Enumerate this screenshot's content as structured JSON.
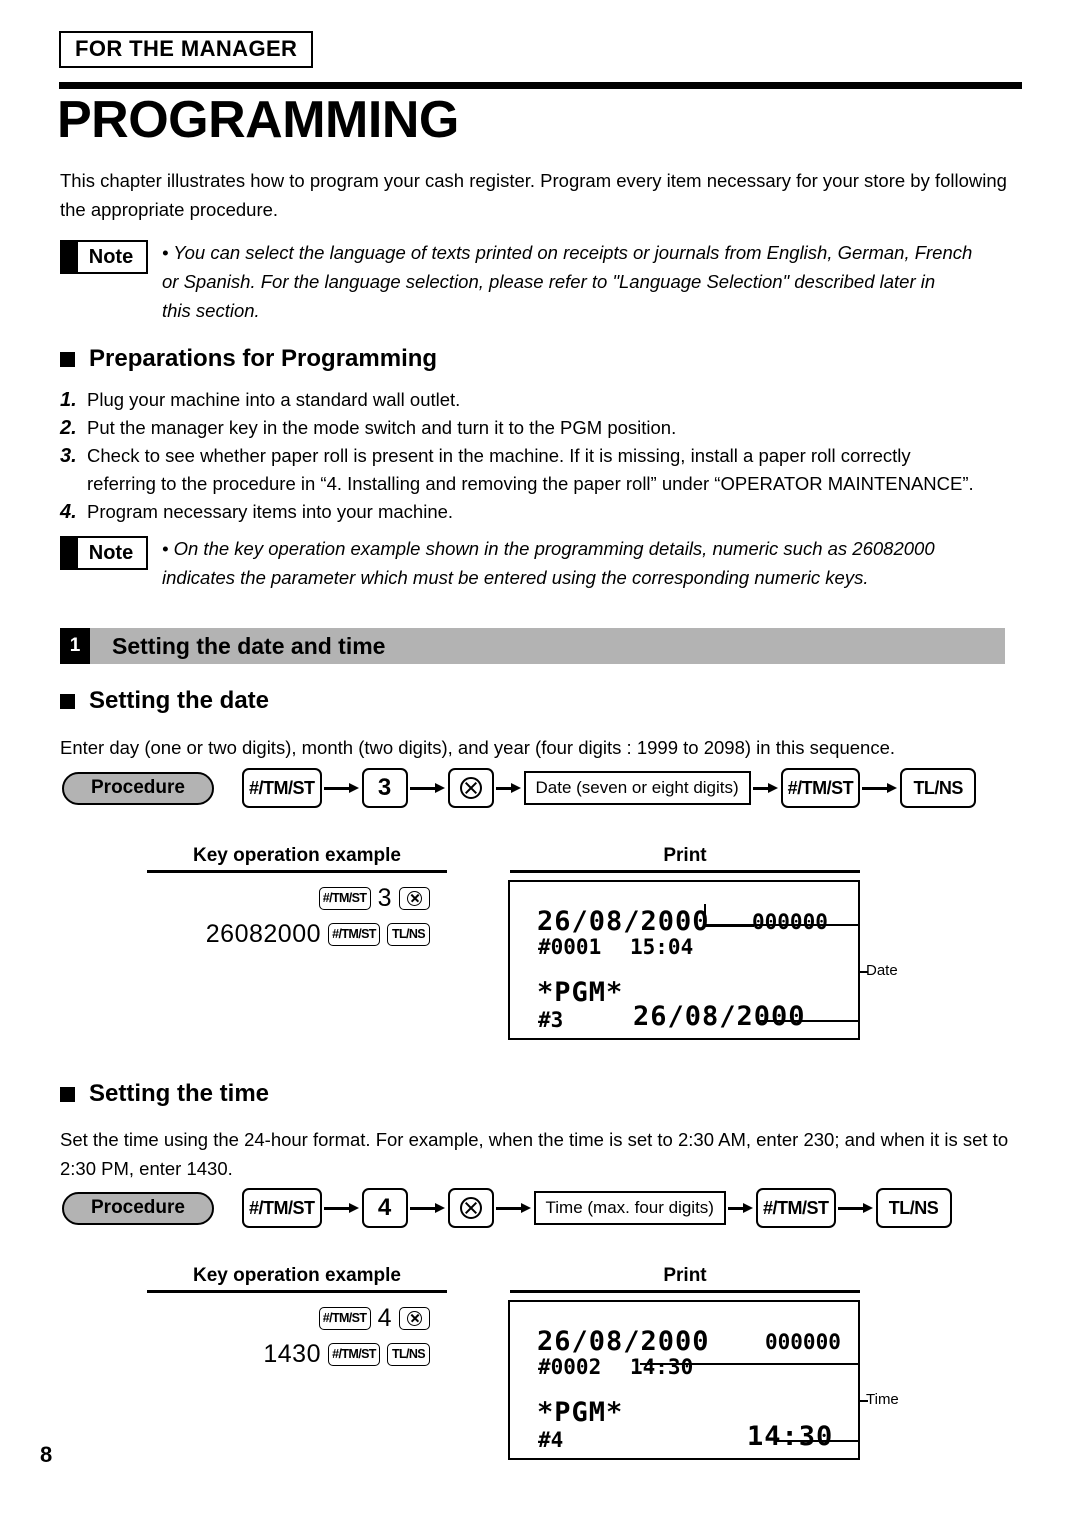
{
  "header": {
    "manager_tag": "FOR THE MANAGER",
    "chapter_title": "PROGRAMMING",
    "intro": "This chapter illustrates how to program your cash register.  Program every item necessary for your store by following the appropriate procedure."
  },
  "note_label": "Note",
  "bullet": "•",
  "note_1": {
    "line1": "• You can select the language of texts printed on receipts or journals from English, German, French",
    "line2": "or Spanish.  For the language selection, please refer to \"Language Selection\" described later in",
    "line3": "this section."
  },
  "preparations": {
    "heading": "Preparations for Programming",
    "items": [
      {
        "num": "1.",
        "text": "Plug your machine into a standard wall outlet."
      },
      {
        "num": "2.",
        "text": "Put the manager key in the mode switch and turn it to the PGM position."
      },
      {
        "num": "3.",
        "text": "Check to see whether paper roll is present in the machine.  If it is missing, install a paper roll correctly",
        "cont": "referring to the procedure in “4. Installing and removing the paper roll” under “OPERATOR MAINTENANCE”."
      },
      {
        "num": "4.",
        "text": "Program necessary items into your machine."
      }
    ]
  },
  "note_2": {
    "line1": "• On the key operation example shown in the programming details, numeric such as 26082000",
    "line2": "indicates the parameter which must be entered using the corresponding numeric keys."
  },
  "section": {
    "number": "1",
    "title": "Setting the date and time"
  },
  "date_section": {
    "heading": "Setting the date",
    "para": "Enter day (one or two digits), month (two digits), and year (four digits : 1999 to 2098) in this sequence.",
    "procedure_label": "Procedure",
    "flow": {
      "key1": "#/TM/ST",
      "key2": "3",
      "key3_icon": "multiply-circle-icon",
      "param": "Date (seven or eight digits)",
      "key4": "#/TM/ST",
      "key5": "TL/NS"
    },
    "example_head": "Key operation example",
    "print_head": "Print",
    "example": {
      "row1_key1": "#/TM/ST",
      "row1_num": "3",
      "row1_icon": "multiply-circle-icon",
      "row2_digits": "26082000",
      "row2_key1": "#/TM/ST",
      "row2_key2": "TL/NS"
    },
    "receipt": {
      "date_line": "26/08/2000",
      "counter": "000000",
      "consec": "#0001",
      "time": "15:04",
      "mode": "*PGM*",
      "code": "#3",
      "value": "26/08/2000",
      "callout": "Date"
    }
  },
  "time_section": {
    "heading": "Setting the time",
    "para": "Set the time using the 24-hour format.  For example, when the time is set to 2:30 AM, enter 230; and when it is set to 2:30 PM, enter 1430.",
    "procedure_label": "Procedure",
    "flow": {
      "key1": "#/TM/ST",
      "key2": "4",
      "key3_icon": "multiply-circle-icon",
      "param": "Time (max. four digits)",
      "key4": "#/TM/ST",
      "key5": "TL/NS"
    },
    "example_head": "Key operation example",
    "print_head": "Print",
    "example": {
      "row1_key1": "#/TM/ST",
      "row1_num": "4",
      "row1_icon": "multiply-circle-icon",
      "row2_digits": "1430",
      "row2_key1": "#/TM/ST",
      "row2_key2": "TL/NS"
    },
    "receipt": {
      "date_line": "26/08/2000",
      "counter": "000000",
      "consec": "#0002",
      "time": "14:30",
      "mode": "*PGM*",
      "code": "#4",
      "value": "14:30",
      "callout": "Time"
    }
  },
  "page_number": "8"
}
